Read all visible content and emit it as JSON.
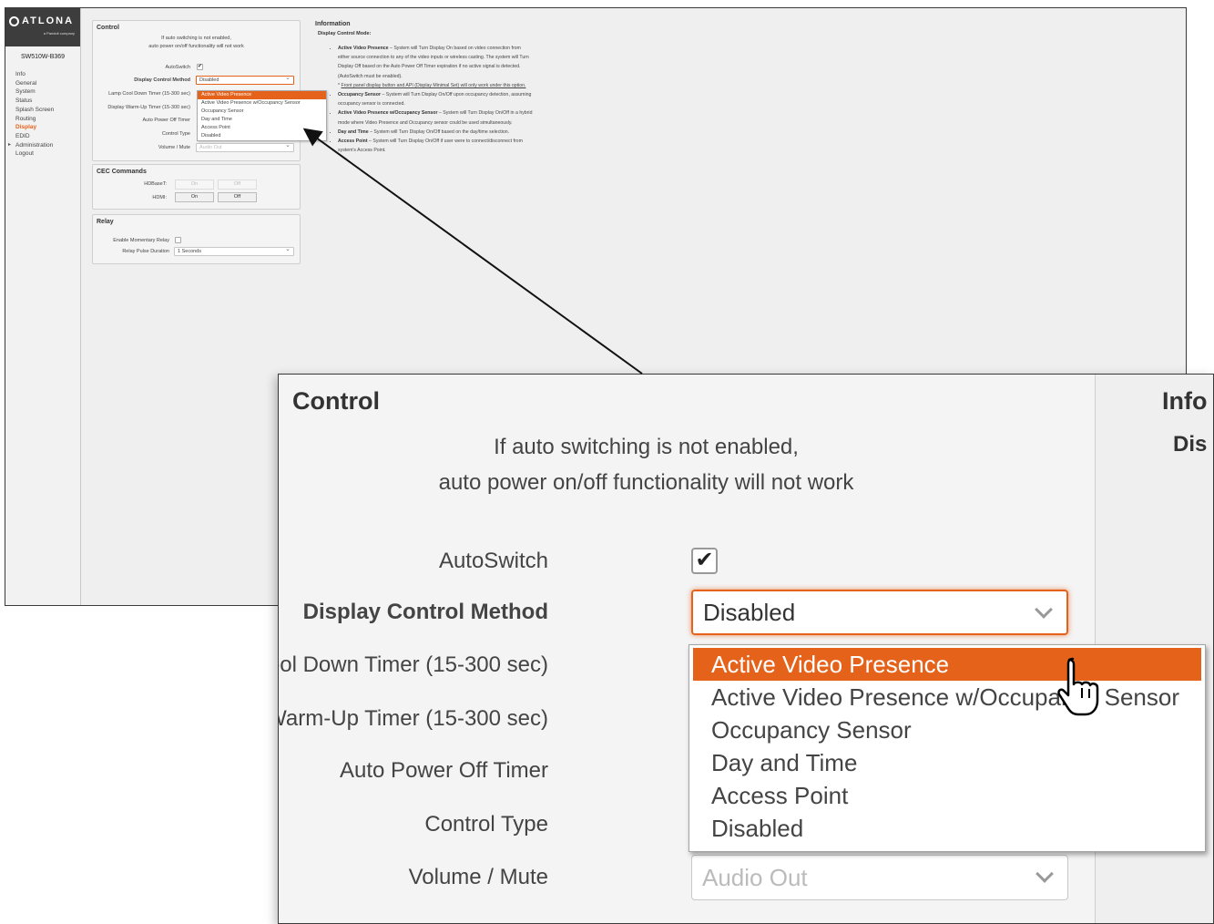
{
  "brand": {
    "logo_text": "ATLONA",
    "logo_sub": "a Panduit company",
    "device_name": "SW510W-B369"
  },
  "nav": [
    {
      "label": "Info",
      "active": false
    },
    {
      "label": "General",
      "active": false
    },
    {
      "label": "System",
      "active": false
    },
    {
      "label": "Status",
      "active": false
    },
    {
      "label": "Splash Screen",
      "active": false
    },
    {
      "label": "Routing",
      "active": false
    },
    {
      "label": "Display",
      "active": true
    },
    {
      "label": "EDID",
      "active": false
    },
    {
      "label": "Administration",
      "active": false
    },
    {
      "label": "Logout",
      "active": false
    }
  ],
  "control": {
    "title": "Control",
    "notice_line1": "If auto switching is not enabled,",
    "notice_line2": "auto power on/off functionality will not work",
    "autoswitch_label": "AutoSwitch",
    "autoswitch_checked": true,
    "method_label": "Display Control Method",
    "method_value": "Disabled",
    "lamp_label": "Lamp Cool Down Timer (15-300 sec)",
    "warmup_label": "Display Warm-Up Timer (15-300 sec)",
    "autopower_label": "Auto Power Off Timer",
    "control_type_label": "Control Type",
    "volume_label": "Volume / Mute",
    "volume_value": "Audio Out",
    "options": [
      "Active Video Presence",
      "Active Video Presence w/Occupancy Sensor",
      "Occupancy Sensor",
      "Day and Time",
      "Access Point",
      "Disabled"
    ],
    "highlighted_option": "Active Video Presence"
  },
  "cec": {
    "title": "CEC Commands",
    "hdbaset_label": "HDBaseT:",
    "hdmi_label": "HDMI:",
    "on_label": "On",
    "off_label": "Off"
  },
  "relay": {
    "title": "Relay",
    "momentary_label": "Enable Momentary Relay",
    "pulse_label": "Relay Pulse Duration",
    "pulse_value": "1 Seconds"
  },
  "information": {
    "title": "Information",
    "subtitle": "Display Control Mode:",
    "items": [
      {
        "term": "Active Video Presence",
        "text": " – System will Turn Display On based on video connection from either source connection to any of the video inputs or wireless casting. The system will Turn Display Off based on the Auto Power Off Timer expiration if no active signal is detected. (AutoSwitch must be enabled)."
      },
      {
        "term": "",
        "text": "* ",
        "underline": "Front panel display button and API (Display Minimal Set) will only work under this option."
      },
      {
        "term": "Occupancy Sensor",
        "text": " – System will Turn Display On/Off upon occupancy detection, assuming occupancy sensor is connected."
      },
      {
        "term": "Active Video Presence w/Occupancy Sensor",
        "text": " – System will Turn Display On/Off in a hybrid mode where Video Presence and Occupancy sensor could be used simultaneously."
      },
      {
        "term": "Day and Time",
        "text": " – System will Turn Display On/Off based on the day/time selection."
      },
      {
        "term": "Access Point",
        "text": " – System will Turn Display On/Off if user were to connect/disconnect from system's Access Point."
      }
    ]
  },
  "zoom": {
    "info_title_partial": "Info",
    "info_sub_partial": "Dis"
  },
  "colors": {
    "accent": "#e5621b",
    "logo_bar": "#3d3d3d",
    "background": "#efefef"
  }
}
